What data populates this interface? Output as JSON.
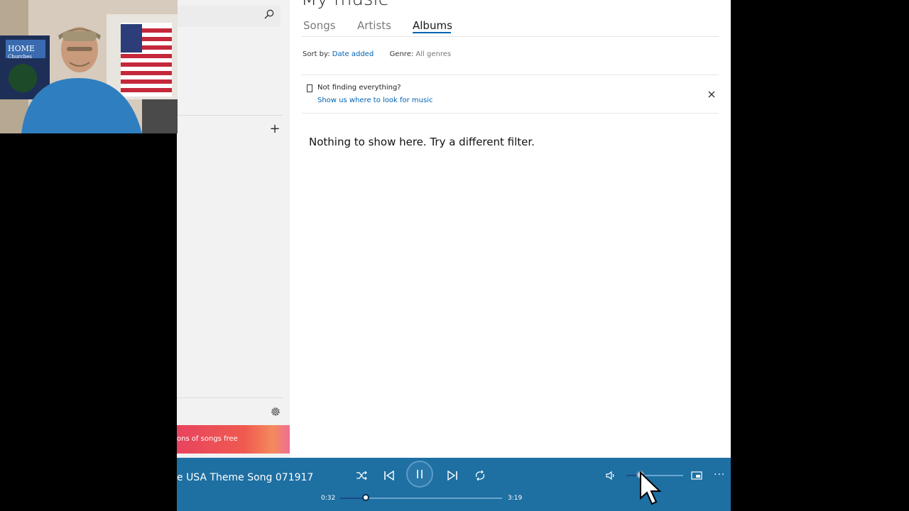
{
  "app": {
    "title": "My music"
  },
  "tabs": [
    {
      "label": "Songs"
    },
    {
      "label": "Artists"
    },
    {
      "label": "Albums"
    }
  ],
  "filters": {
    "sort_label": "Sort by:",
    "sort_value": "Date added",
    "genre_label": "Genre:",
    "genre_value": "All genres"
  },
  "notice": {
    "title": "Not finding everything?",
    "link": "Show us where to look for music"
  },
  "empty_message": "Nothing to show here. Try a different filter.",
  "sidebar": {
    "promo_text": "ons of songs free"
  },
  "player": {
    "now_playing": "e USA Theme Song 071917",
    "elapsed": "0:32",
    "duration": "3:19",
    "progress_fraction": 0.16,
    "volume_fraction": 0.25
  },
  "webcam": {
    "sign_text": "HOME Churches"
  },
  "icons": {
    "search": "search-icon",
    "add": "plus-icon",
    "settings": "gear-icon",
    "close": "close-icon",
    "shuffle": "shuffle-icon",
    "previous": "previous-icon",
    "pause": "pause-icon",
    "next": "next-icon",
    "repeat": "repeat-icon",
    "volume": "volume-icon",
    "mini_view": "mini-view-icon",
    "more": "more-icon"
  },
  "colors": {
    "accent": "#0063b1",
    "player_bg": "#1e6fa2",
    "promo_start": "#e9435f",
    "promo_end": "#f06e93"
  }
}
